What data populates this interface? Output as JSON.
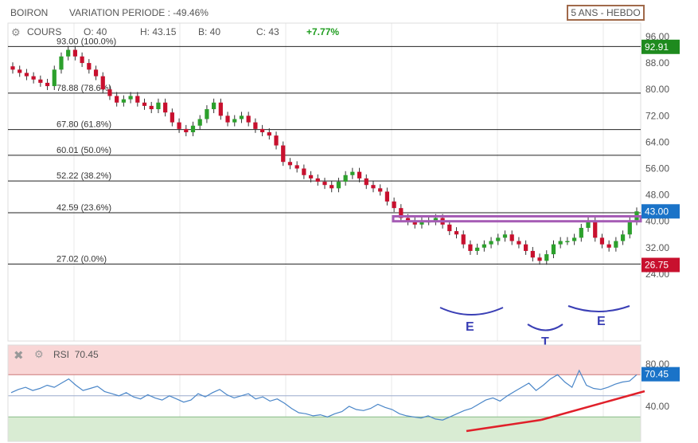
{
  "header": {
    "symbol": "BOIRON",
    "variation": "VARIATION PERIODE : -49.46%",
    "period_button": "5 ANS - HEBDO"
  },
  "ohlc_bar": {
    "series_name": "COURS",
    "open": "O: 40",
    "high": "H: 43.15",
    "low": "B: 40",
    "close": "C: 43",
    "change": "+7.77%"
  },
  "rsi_panel": {
    "label": "RSI",
    "value": "70.45"
  },
  "colors": {
    "up": "#2ca02c",
    "down": "#c8102e",
    "rsi_line": "#4a86c8",
    "trendline": "#e0202a",
    "resistance_box": "#a55cb5",
    "pattern_arcs": "#3a3fb5",
    "last_price_badge": "#1a73c8",
    "high_badge": "#1e8a1e",
    "low_badge": "#c8102e",
    "period_border": "#a0694a"
  },
  "chart_data": [
    {
      "type": "candlestick",
      "series_name": "COURS",
      "y_axis_ticks": [
        "96.00",
        "88.00",
        "80.00",
        "72.00",
        "64.00",
        "56.00",
        "48.00",
        "40.00",
        "32.00",
        "24.00"
      ],
      "ylim": [
        22,
        97
      ],
      "x": "weekly, 5 years",
      "close_path": [
        86,
        85,
        84,
        83,
        82,
        81,
        86,
        90,
        92,
        90,
        88,
        86,
        84,
        80,
        78,
        76,
        77,
        78,
        76,
        75,
        74,
        76,
        73,
        70,
        68,
        67,
        69,
        71,
        74,
        76,
        72,
        70,
        71,
        72,
        70,
        68,
        67,
        66,
        63,
        58,
        57,
        56,
        54,
        53,
        52,
        51,
        50,
        52,
        54,
        55,
        53,
        51,
        50,
        49,
        46,
        44,
        41,
        40,
        39,
        40,
        40,
        41,
        39,
        37,
        36,
        33,
        31,
        32,
        33,
        34,
        35,
        36,
        34,
        33,
        31,
        29,
        28,
        30,
        33,
        34,
        34,
        35,
        38,
        40,
        35,
        33,
        32,
        34,
        36,
        40,
        43
      ],
      "price_badges": {
        "last": "43.00",
        "high": "92.91",
        "low": "26.75"
      },
      "fibonacci_levels": [
        {
          "value": 93.0,
          "label": "93.00  (100.0%)"
        },
        {
          "value": 78.88,
          "label": "78.88  (78.6%)"
        },
        {
          "value": 67.8,
          "label": "67.80  (61.8%)"
        },
        {
          "value": 60.01,
          "label": "60.01  (50.0%)"
        },
        {
          "value": 52.22,
          "label": "52.22  (38.2%)"
        },
        {
          "value": 42.59,
          "label": "42.59  (23.6%)"
        },
        {
          "value": 27.02,
          "label": "27.02  (0.0%)"
        }
      ],
      "resistance_zone": [
        40,
        41.5
      ],
      "annotations": [
        "E",
        "T",
        "E"
      ]
    },
    {
      "type": "line",
      "series_name": "RSI",
      "y_axis_ticks": [
        "80.00",
        "40.00"
      ],
      "ylim": [
        20,
        90
      ],
      "overbought": 70,
      "oversold": 30,
      "mid": 50,
      "last_badge": "70.45",
      "values": [
        53,
        56,
        58,
        55,
        57,
        60,
        58,
        62,
        66,
        60,
        55,
        57,
        59,
        54,
        52,
        50,
        53,
        49,
        47,
        51,
        48,
        46,
        50,
        47,
        44,
        46,
        52,
        49,
        53,
        56,
        51,
        48,
        50,
        52,
        47,
        49,
        45,
        47,
        43,
        38,
        34,
        33,
        31,
        32,
        30,
        33,
        35,
        40,
        37,
        36,
        38,
        42,
        39,
        37,
        33,
        31,
        30,
        29,
        31,
        28,
        27,
        30,
        33,
        36,
        38,
        42,
        46,
        48,
        45,
        50,
        54,
        58,
        62,
        55,
        60,
        66,
        70,
        63,
        58,
        74,
        60,
        57,
        56,
        58,
        61,
        63,
        64,
        70
      ]
    }
  ]
}
